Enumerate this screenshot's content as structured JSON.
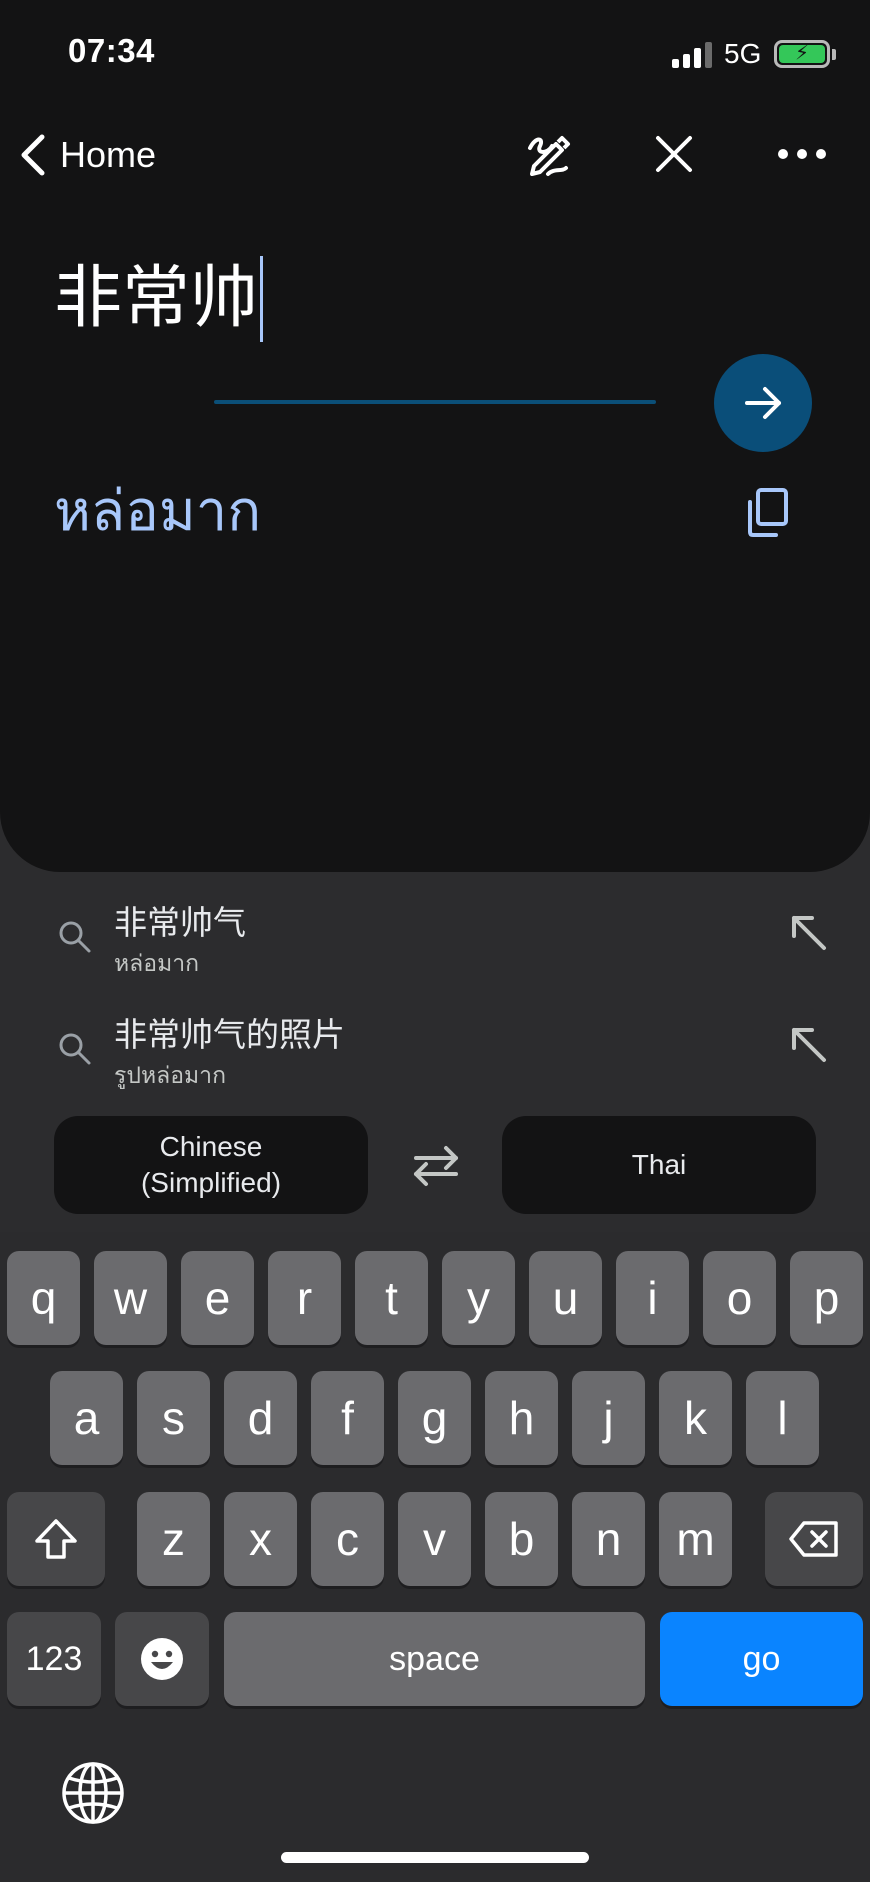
{
  "status_bar": {
    "time": "07:34",
    "network": "5G",
    "battery_icon": "battery-charging-icon"
  },
  "nav": {
    "back_label": "Home"
  },
  "source": {
    "text": "非常帅"
  },
  "translation": {
    "text": "หล่อมาก"
  },
  "suggestions": [
    {
      "main": "非常帅气",
      "sub": "หล่อมาก"
    },
    {
      "main": "非常帅气的照片",
      "sub": "รูปหล่อมาก"
    }
  ],
  "languages": {
    "source_line1": "Chinese",
    "source_line2": "(Simplified)",
    "target": "Thai"
  },
  "keyboard": {
    "row1": [
      "q",
      "w",
      "e",
      "r",
      "t",
      "y",
      "u",
      "i",
      "o",
      "p"
    ],
    "row2": [
      "a",
      "s",
      "d",
      "f",
      "g",
      "h",
      "j",
      "k",
      "l"
    ],
    "row3": [
      "z",
      "x",
      "c",
      "v",
      "b",
      "n",
      "m"
    ],
    "numbers_label": "123",
    "space_label": "space",
    "go_label": "go"
  },
  "colors": {
    "accent": "#a8c7fa",
    "go_key": "#0a84ff",
    "arrow_button": "#0a4e79"
  }
}
